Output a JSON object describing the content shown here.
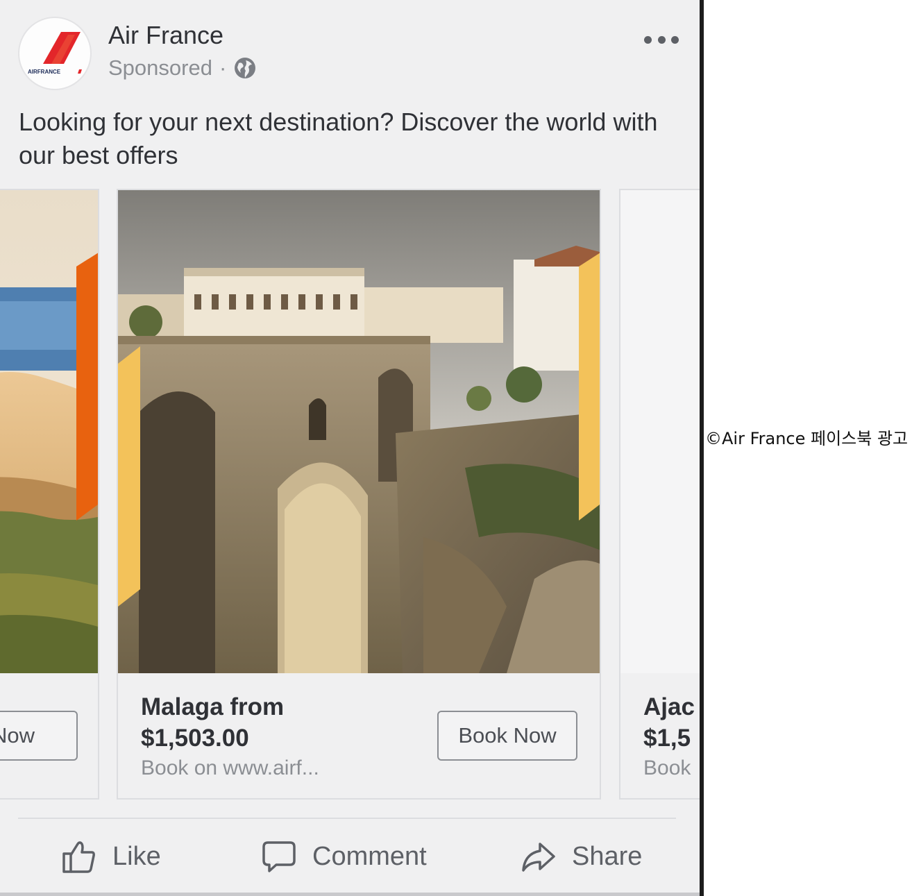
{
  "post": {
    "page_name": "Air France",
    "sponsored_label": "Sponsored",
    "separator": "·",
    "avatar_logo_text": "AIRFRANCE",
    "body_text": "Looking for your next destination? Discover the world with our best offers"
  },
  "cards": [
    {
      "button_label": "k Now"
    },
    {
      "title_line1": "Malaga from",
      "title_line2": "$1,503.00",
      "subtitle": "Book on www.airf...",
      "button_label": "Book Now"
    },
    {
      "title_line1": "Ajac",
      "title_line2": "$1,5",
      "subtitle": "Book"
    }
  ],
  "actions": {
    "like": "Like",
    "comment": "Comment",
    "share": "Share"
  },
  "credit": "©Air France 페이스북 광고",
  "icons": {
    "globe": "globe-icon",
    "more": "more-options-icon",
    "like": "thumbs-up-icon",
    "comment": "comment-bubble-icon",
    "share": "share-arrow-icon"
  },
  "colors": {
    "brand_red": "#e3262a",
    "accent_orange": "#e8620f",
    "accent_yellow": "#f3c25a",
    "text_primary": "#2f3136",
    "text_secondary": "#8b8e93"
  }
}
